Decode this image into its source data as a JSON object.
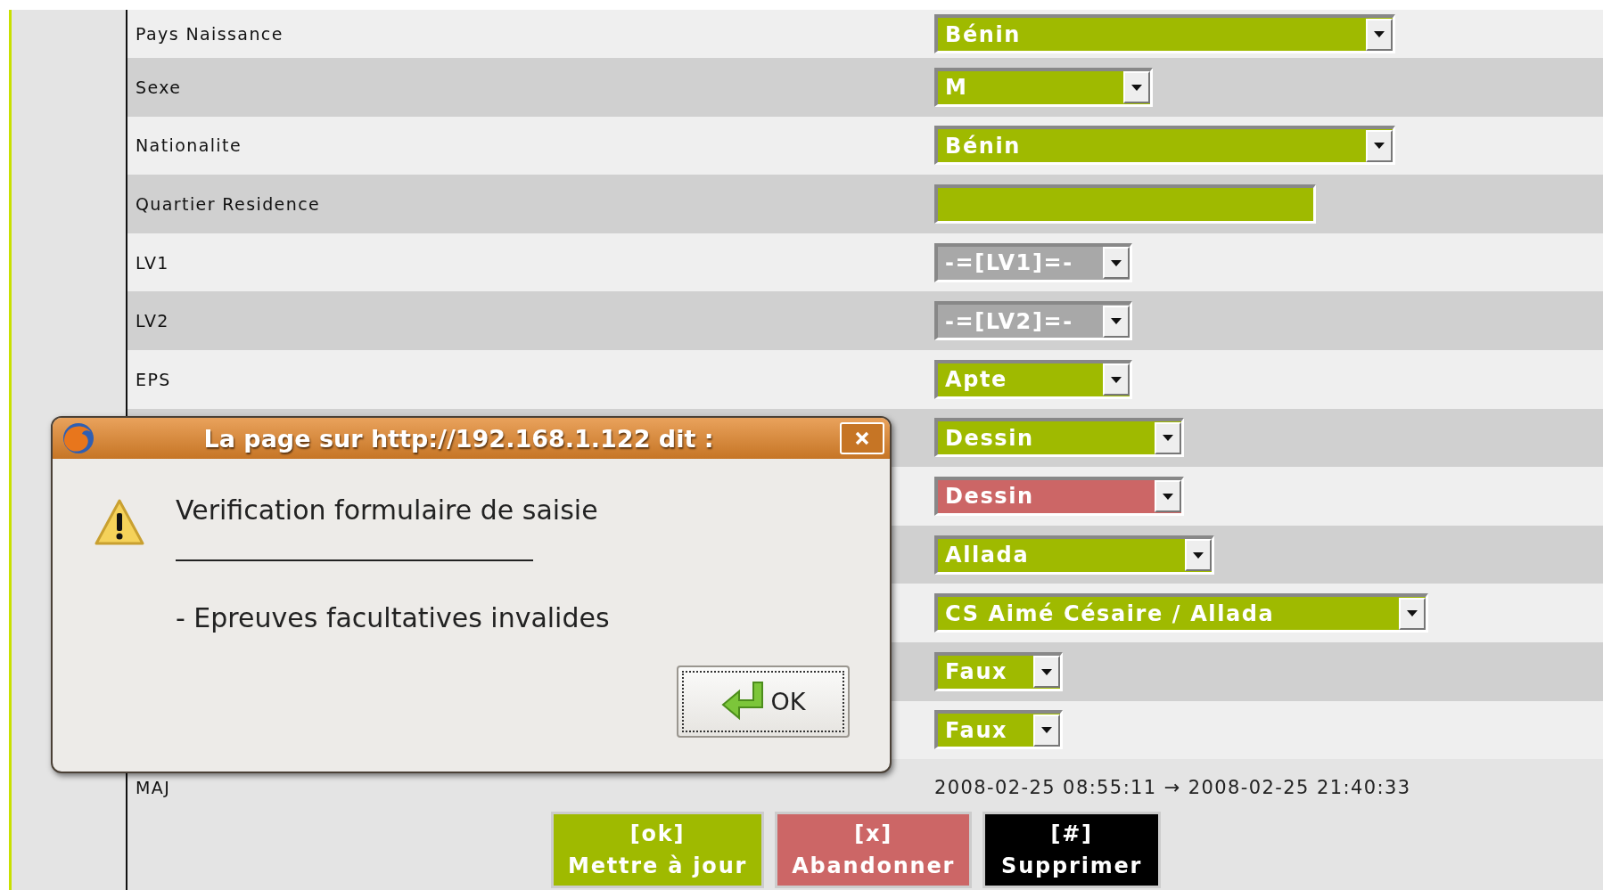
{
  "form": {
    "rows": [
      {
        "label": "Pays Naissance",
        "kind": "select",
        "value": "Bénin",
        "color": "#9fba00"
      },
      {
        "label": "Sexe",
        "kind": "select",
        "value": "M",
        "color": "#9fba00"
      },
      {
        "label": "Nationalite",
        "kind": "select",
        "value": "Bénin",
        "color": "#9fba00"
      },
      {
        "label": "Quartier Residence",
        "kind": "input",
        "color": "#9fba00"
      },
      {
        "label": "LV1",
        "kind": "select",
        "value": "-=[LV1]=-",
        "color": "#a8a8a8"
      },
      {
        "label": "LV2",
        "kind": "select",
        "value": "-=[LV2]=-",
        "color": "#a8a8a8"
      },
      {
        "label": "EPS",
        "kind": "select",
        "value": "Apte",
        "color": "#9fba00"
      },
      {
        "kind": "select",
        "value": "Dessin",
        "color": "#9fba00"
      },
      {
        "kind": "select",
        "value": "Dessin",
        "color": "#cc6666"
      },
      {
        "kind": "select",
        "value": "Allada",
        "color": "#9fba00"
      },
      {
        "kind": "select",
        "value": "CS Aimé Césaire / Allada",
        "color": "#9fba00"
      },
      {
        "kind": "select",
        "value": "Faux",
        "color": "#9fba00"
      },
      {
        "kind": "select",
        "value": "Faux",
        "color": "#9fba00"
      }
    ],
    "update": {
      "label": "MAJ",
      "value": "2008-02-25 08:55:11 → 2008-02-25 21:40:33"
    }
  },
  "buttons": [
    {
      "key": "[ok]",
      "label": "Mettre à jour",
      "color": "#9fba00"
    },
    {
      "key": "[x]",
      "label": "Abandonner",
      "color": "#cc6666"
    },
    {
      "key": "[#]",
      "label": "Supprimer",
      "color": "#000000"
    }
  ],
  "dialog": {
    "title": "La page sur http://192.168.1.122 dit :",
    "message": "Verification formulaire de saisie",
    "detail": "- Epreuves facultatives invalides",
    "button": "OK"
  }
}
